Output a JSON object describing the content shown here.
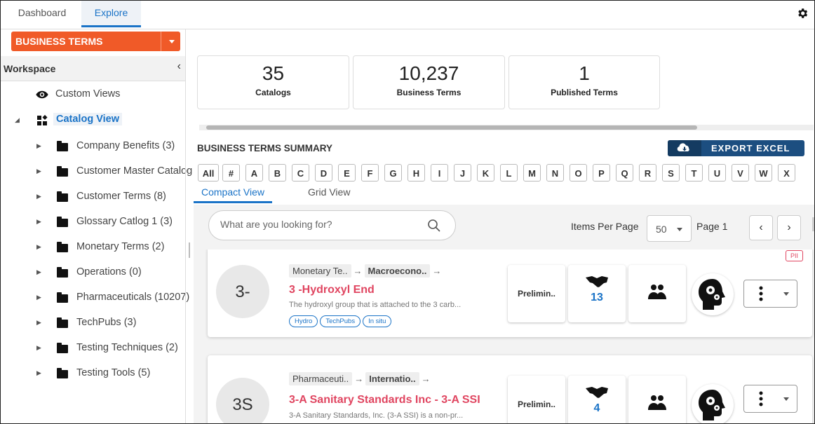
{
  "top_tabs": {
    "dashboard": "Dashboard",
    "explore": "Explore"
  },
  "icons": {
    "settings": "gear-icon",
    "custom_views": "eye-icon",
    "catalog_view": "grid-layout-icon",
    "folder": "folder-icon",
    "export": "cloud-download-icon",
    "search": "search-icon",
    "stewardship": "handshake-icon",
    "users": "users-icon",
    "ai": "brain-gears-icon",
    "actions": "kebab-icon"
  },
  "colors": {
    "accent": "#1a73c7",
    "brand_orange": "#f05a28",
    "term_title": "#e04560",
    "export_button": "#1c4e80"
  },
  "module_select": {
    "label": "BUSINESS TERMS"
  },
  "workspace": {
    "title": "Workspace",
    "collapse": "‹",
    "custom_views": "Custom Views",
    "catalog_view": "Catalog View",
    "folders": [
      "Company Benefits (3)",
      "Customer Master Catalog",
      "Customer Terms (8)",
      "Glossary Catlog 1 (3)",
      "Monetary Terms (2)",
      "Operations (0)",
      "Pharmaceuticals (10207)",
      "TechPubs (3)",
      "Testing Techniques (2)",
      "Testing Tools (5)"
    ]
  },
  "stats": [
    {
      "value": "35",
      "label": "Catalogs"
    },
    {
      "value": "10,237",
      "label": "Business Terms"
    },
    {
      "value": "1",
      "label": "Published Terms"
    }
  ],
  "summary": {
    "title": "BUSINESS TERMS SUMMARY",
    "export_label": "EXPORT EXCEL"
  },
  "alphabet": [
    "All",
    "#",
    "A",
    "B",
    "C",
    "D",
    "E",
    "F",
    "G",
    "H",
    "I",
    "J",
    "K",
    "L",
    "M",
    "N",
    "O",
    "P",
    "Q",
    "R",
    "S",
    "T",
    "U",
    "V",
    "W",
    "X"
  ],
  "view_tabs": {
    "compact": "Compact View",
    "grid": "Grid View"
  },
  "search": {
    "placeholder": "What are you looking for?"
  },
  "pagination": {
    "items_per_page_label": "Items Per Page",
    "items_per_page": "50",
    "page_label": "Page 1",
    "prev": "‹",
    "next": "›"
  },
  "terms": [
    {
      "avatar": "3-",
      "crumb1": "Monetary Te..",
      "crumb2": "Macroecono..",
      "title": "3 -Hydroxyl End",
      "description": "The hydroxyl group that is attached to the 3 carb...",
      "tags": [
        "Hydro",
        "TechPubs",
        "In situ"
      ],
      "badge": "PII",
      "status": "Prelimin..",
      "count": "13"
    },
    {
      "avatar": "3S",
      "crumb1": "Pharmaceuti..",
      "crumb2": "Internatio..",
      "title": "3-A Sanitary Standards Inc - 3-A SSI",
      "description": "3-A Sanitary Standards, Inc. (3-A SSI) is a non-pr...",
      "tags": [],
      "badge": "",
      "status": "Prelimin..",
      "count": "4"
    }
  ],
  "arrow": "→"
}
